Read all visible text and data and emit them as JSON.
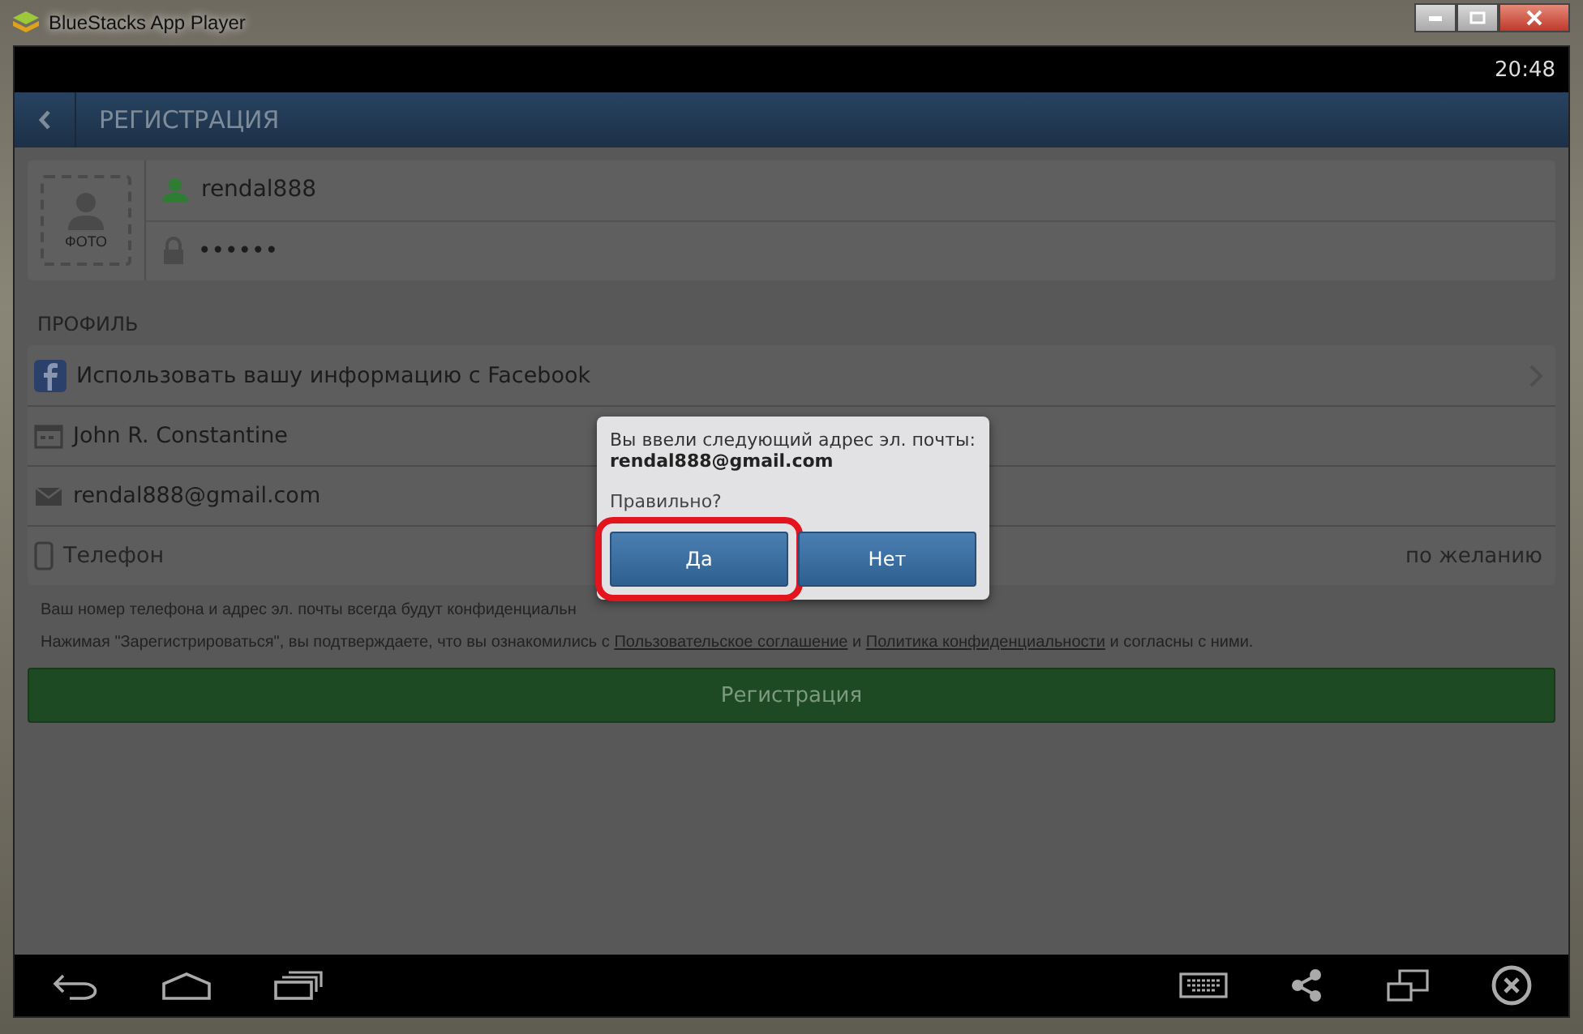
{
  "window": {
    "title": "BlueStacks App Player"
  },
  "status_bar": {
    "time": "20:48"
  },
  "header": {
    "title": "РЕГИСТРАЦИЯ"
  },
  "account": {
    "photo_label": "ФОТО",
    "username": "rendal888",
    "password": "••••••"
  },
  "section_title": "ПРОФИЛЬ",
  "rows": [
    {
      "kind": "facebook",
      "text": "Использовать вашу информацию с Facebook"
    },
    {
      "kind": "name",
      "text": "John R. Constantine"
    },
    {
      "kind": "email",
      "text": "rendal888@gmail.com"
    },
    {
      "kind": "phone",
      "placeholder": "Телефон",
      "hint": "по желанию"
    }
  ],
  "notes": {
    "privacy": "Ваш номер телефона и адрес эл. почты всегда будут конфиденциальн",
    "terms_before": "Нажимая \"Зарегистрироваться\", вы подтверждаете, что вы ознакомились с",
    "terms_link": "Пользовательское соглашение",
    "terms_and": "и",
    "privacy_link": "Политика конфиденциальности",
    "terms_after": "и согласны с ними."
  },
  "register_button": "Регистрация",
  "dialog": {
    "message": "Вы ввели следующий адрес эл. почты:",
    "email": "rendal888@gmail.com",
    "question": "Правильно?",
    "buttons": [
      {
        "label": "Да",
        "highlighted": true
      },
      {
        "label": "Нет",
        "highlighted": false
      }
    ]
  }
}
